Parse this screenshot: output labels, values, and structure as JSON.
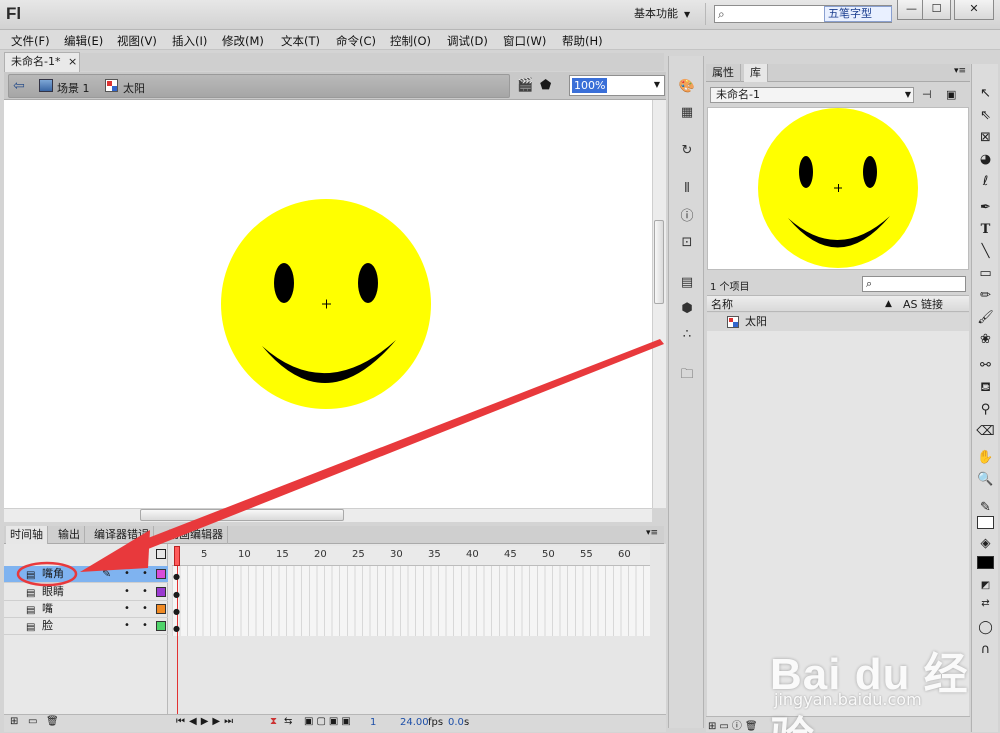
{
  "app": {
    "logo": "Fl",
    "workspace": "基本功能",
    "wubi_label": "五笔字型"
  },
  "window_controls": {
    "minimize": "—",
    "maximize": "☐",
    "close": "✕"
  },
  "menu": [
    "文件(F)",
    "编辑(E)",
    "视图(V)",
    "插入(I)",
    "修改(M)",
    "文本(T)",
    "命令(C)",
    "控制(O)",
    "调试(D)",
    "窗口(W)",
    "帮助(H)"
  ],
  "document": {
    "tab_label": "未命名-1*",
    "tab_close": "×",
    "breadcrumb": {
      "scene": "场景 1",
      "symbol": "太阳"
    },
    "zoom": "100%"
  },
  "timeline": {
    "tabs": [
      "时间轴",
      "输出",
      "编译器错误",
      "动画编辑器"
    ],
    "ruler": [
      "1",
      "5",
      "10",
      "15",
      "20",
      "25",
      "30",
      "35",
      "40",
      "45",
      "50",
      "55",
      "60"
    ],
    "layers": [
      {
        "name": "嘴角",
        "color": "#d94cd9",
        "selected": true
      },
      {
        "name": "眼睛",
        "color": "#9a3ad0",
        "selected": false
      },
      {
        "name": "嘴",
        "color": "#f08a24",
        "selected": false
      },
      {
        "name": "脸",
        "color": "#4fd36a",
        "selected": false
      }
    ],
    "current_frame": "1",
    "fps": "24.00",
    "fps_unit": "fps",
    "elapsed": "0.0",
    "elapsed_unit": "s"
  },
  "library": {
    "tabs": [
      "属性",
      "库"
    ],
    "document": "未命名-1",
    "item_count": "1 个项目",
    "columns": {
      "name": "名称",
      "linkage": "AS 链接"
    },
    "items": [
      {
        "name": "太阳"
      }
    ]
  },
  "watermark": {
    "brand": "Bai du 经验",
    "url": "jingyan.baidu.com"
  },
  "colors": {
    "sun": "#ffff00",
    "stroke_swatch": "#ffffff",
    "fill_swatch": "#000000",
    "arrow": "#e8393c"
  }
}
